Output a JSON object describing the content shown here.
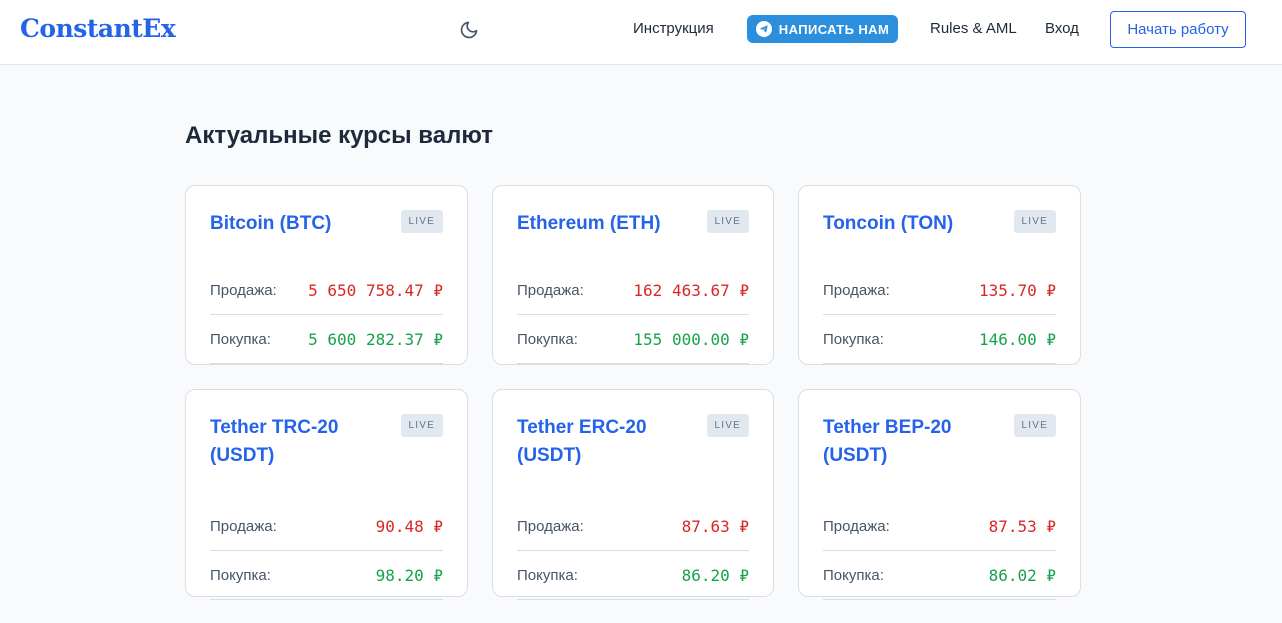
{
  "header": {
    "logo": "ConstantEx",
    "theme_icon": "moon-icon",
    "nav": {
      "instructions": "Инструкция",
      "telegram": "НАПИСАТЬ НАМ",
      "rules": "Rules & AML",
      "login": "Вход",
      "start": "Начать работу"
    }
  },
  "main": {
    "title": "Актуальные курсы валют",
    "sell_label": "Продажа:",
    "buy_label": "Покупка:",
    "cards": [
      {
        "name": "Bitcoin (BTC)",
        "badge": "LIVE",
        "sell": "5 650 758.47 ₽",
        "buy": "5 600 282.37 ₽"
      },
      {
        "name": "Ethereum (ETH)",
        "badge": "LIVE",
        "sell": "162 463.67 ₽",
        "buy": "155 000.00 ₽"
      },
      {
        "name": "Toncoin (TON)",
        "badge": "LIVE",
        "sell": "135.70 ₽",
        "buy": "146.00 ₽"
      },
      {
        "name": "Tether TRC-20 (USDT)",
        "badge": "LIVE",
        "sell": "90.48 ₽",
        "buy": "98.20 ₽"
      },
      {
        "name": "Tether ERC-20 (USDT)",
        "badge": "LIVE",
        "sell": "87.63 ₽",
        "buy": "86.20 ₽"
      },
      {
        "name": "Tether BEP-20 (USDT)",
        "badge": "LIVE",
        "sell": "87.53 ₽",
        "buy": "86.02 ₽"
      }
    ]
  },
  "colors": {
    "accent": "#2563eb",
    "sell": "#dc2626",
    "buy": "#16a34a",
    "telegram": "#2b8fde"
  }
}
